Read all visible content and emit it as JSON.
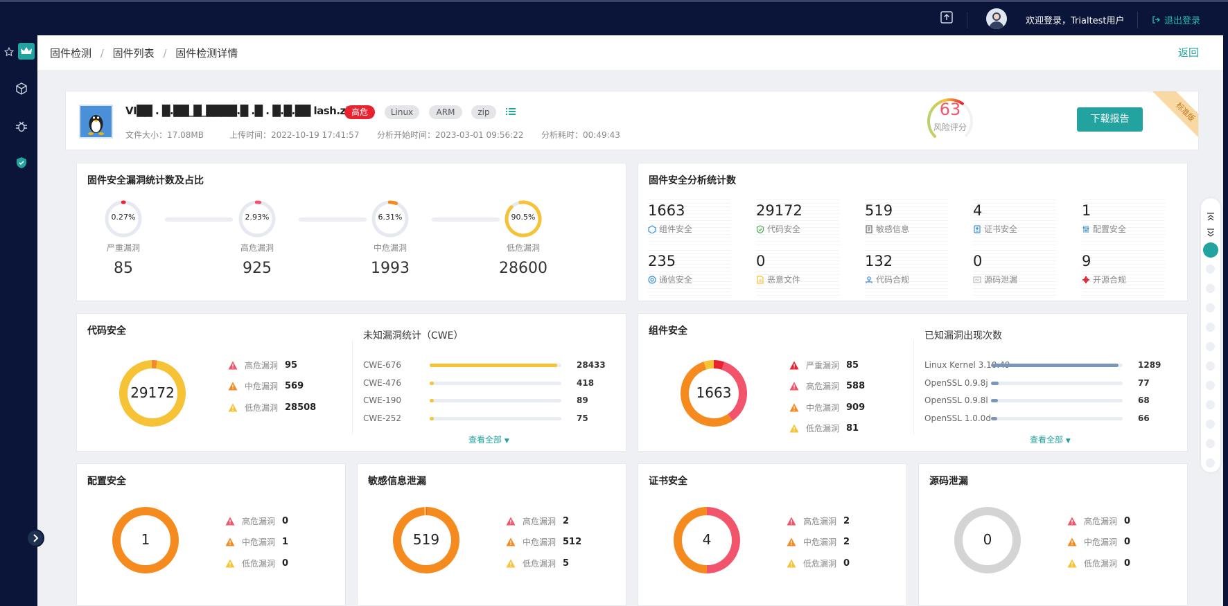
{
  "topbar": {
    "upload_icon": "upload-icon",
    "welcome": "欢迎登录，Trialtest用户",
    "logout": "退出登录"
  },
  "breadcrumb": {
    "items": [
      "固件检测",
      "固件列表",
      "固件检测详情"
    ],
    "separator": "/",
    "back": "返回"
  },
  "firmware": {
    "name": "VI██ . █.██_█_████.█ .█ . █.█.██ lash.zip",
    "level": "高危",
    "tags": [
      "Linux",
      "ARM",
      "zip"
    ],
    "size": "文件大小：17.08MB",
    "upload_time": "上传时间：2022-10-19 17:41:57",
    "analysis_start": "分析开始时间：2023-03-01 09:56:22",
    "duration": "分析耗时：00:49:43",
    "risk_score": "63",
    "risk_score_label": "风险评分",
    "risk_value": 63,
    "download": "下载报告",
    "edition": "标准版"
  },
  "vuln_stats": {
    "title": "固件安全漏洞统计数及占比",
    "items": [
      {
        "pct": "0.27%",
        "ratio": 0.0027,
        "label": "严重漏洞",
        "count": "85",
        "color": "#e8222e"
      },
      {
        "pct": "2.93%",
        "ratio": 0.0293,
        "label": "高危漏洞",
        "count": "925",
        "color": "#f2546b"
      },
      {
        "pct": "6.31%",
        "ratio": 0.0631,
        "label": "中危漏洞",
        "count": "1993",
        "color": "#f58a1e"
      },
      {
        "pct": "90.5%",
        "ratio": 0.905,
        "label": "低危漏洞",
        "count": "28600",
        "color": "#f6c236"
      }
    ]
  },
  "analysis_stats": {
    "title": "固件安全分析统计数",
    "items": [
      {
        "value": "1663",
        "label": "组件安全",
        "icon": "component-icon",
        "color": "#3b8fd8"
      },
      {
        "value": "29172",
        "label": "代码安全",
        "icon": "shield-check-icon",
        "color": "#4caf50"
      },
      {
        "value": "519",
        "label": "敏感信息",
        "icon": "document-icon",
        "color": "#666"
      },
      {
        "value": "4",
        "label": "证书安全",
        "icon": "certificate-icon",
        "color": "#3b8fd8"
      },
      {
        "value": "1",
        "label": "配置安全",
        "icon": "sliders-icon",
        "color": "#3b8fd8"
      },
      {
        "value": "235",
        "label": "通信安全",
        "icon": "wifi-icon",
        "color": "#3b8fd8"
      },
      {
        "value": "0",
        "label": "恶意文件",
        "icon": "malicious-file-icon",
        "color": "#f6c236"
      },
      {
        "value": "132",
        "label": "代码合规",
        "icon": "compliance-icon",
        "color": "#3b8fd8"
      },
      {
        "value": "0",
        "label": "源码泄漏",
        "icon": "source-leak-icon",
        "color": "#bbb"
      },
      {
        "value": "9",
        "label": "开源合规",
        "icon": "open-source-icon",
        "color": "#e8222e"
      }
    ]
  },
  "code_security": {
    "title": "代码安全",
    "total": "29172",
    "severity": [
      {
        "label": "高危漏洞",
        "value": "95",
        "n": 95,
        "color": "#f2546b"
      },
      {
        "label": "中危漏洞",
        "value": "569",
        "n": 569,
        "color": "#f58a1e"
      },
      {
        "label": "低危漏洞",
        "value": "28508",
        "n": 28508,
        "color": "#f6c236"
      }
    ],
    "cwe_title": "未知漏洞统计（CWE）",
    "cwe": [
      {
        "name": "CWE-676",
        "value": "28433",
        "n": 28433
      },
      {
        "name": "CWE-476",
        "value": "418",
        "n": 418
      },
      {
        "name": "CWE-190",
        "value": "89",
        "n": 89
      },
      {
        "name": "CWE-252",
        "value": "75",
        "n": 75
      }
    ],
    "view_all": "查看全部"
  },
  "component_security": {
    "title": "组件安全",
    "total": "1663",
    "severity": [
      {
        "label": "严重漏洞",
        "value": "85",
        "n": 85,
        "color": "#e8222e"
      },
      {
        "label": "高危漏洞",
        "value": "588",
        "n": 588,
        "color": "#f2546b"
      },
      {
        "label": "中危漏洞",
        "value": "909",
        "n": 909,
        "color": "#f58a1e"
      },
      {
        "label": "低危漏洞",
        "value": "81",
        "n": 81,
        "color": "#f6c236"
      }
    ],
    "known_title": "已知漏洞出现次数",
    "known": [
      {
        "name": "Linux Kernel 3.10.49",
        "value": "1289",
        "n": 1289
      },
      {
        "name": "OpenSSL 0.9.8j",
        "value": "77",
        "n": 77
      },
      {
        "name": "OpenSSL 0.9.8l",
        "value": "68",
        "n": 68
      },
      {
        "name": "OpenSSL 1.0.0d",
        "value": "66",
        "n": 66
      }
    ],
    "view_all": "查看全部"
  },
  "config_security": {
    "title": "配置安全",
    "total": "1",
    "severity": [
      {
        "label": "高危漏洞",
        "value": "0",
        "n": 0,
        "color": "#f2546b"
      },
      {
        "label": "中危漏洞",
        "value": "1",
        "n": 1,
        "color": "#f58a1e"
      },
      {
        "label": "低危漏洞",
        "value": "0",
        "n": 0,
        "color": "#f6c236"
      }
    ]
  },
  "sensitive_info": {
    "title": "敏感信息泄漏",
    "total": "519",
    "severity": [
      {
        "label": "高危漏洞",
        "value": "2",
        "n": 2,
        "color": "#f2546b"
      },
      {
        "label": "中危漏洞",
        "value": "512",
        "n": 512,
        "color": "#f58a1e"
      },
      {
        "label": "低危漏洞",
        "value": "5",
        "n": 5,
        "color": "#f6c236"
      }
    ]
  },
  "cert_security": {
    "title": "证书安全",
    "total": "4",
    "severity": [
      {
        "label": "高危漏洞",
        "value": "2",
        "n": 2,
        "color": "#f2546b"
      },
      {
        "label": "中危漏洞",
        "value": "2",
        "n": 2,
        "color": "#f58a1e"
      },
      {
        "label": "低危漏洞",
        "value": "0",
        "n": 0,
        "color": "#f6c236"
      }
    ]
  },
  "source_leak": {
    "title": "源码泄漏",
    "total": "0",
    "severity": [
      {
        "label": "高危漏洞",
        "value": "0",
        "n": 0,
        "color": "#f2546b"
      },
      {
        "label": "中危漏洞",
        "value": "0",
        "n": 0,
        "color": "#f58a1e"
      },
      {
        "label": "低危漏洞",
        "value": "0",
        "n": 0,
        "color": "#f6c236"
      }
    ]
  },
  "colors": {
    "nav_bg": "#0b1539",
    "accent": "#22a39f",
    "critical": "#e8222e",
    "high": "#f2546b",
    "medium": "#f58a1e",
    "low": "#f6c236",
    "empty": "#d4d4d4"
  },
  "sidebar_icons": [
    "star-icon",
    "crown-logo-icon",
    "cube-icon",
    "bug-icon",
    "shield-icon",
    "expand-icon"
  ],
  "right_rail_icons": [
    "collapse-up-icon",
    "collapse-down-icon"
  ]
}
